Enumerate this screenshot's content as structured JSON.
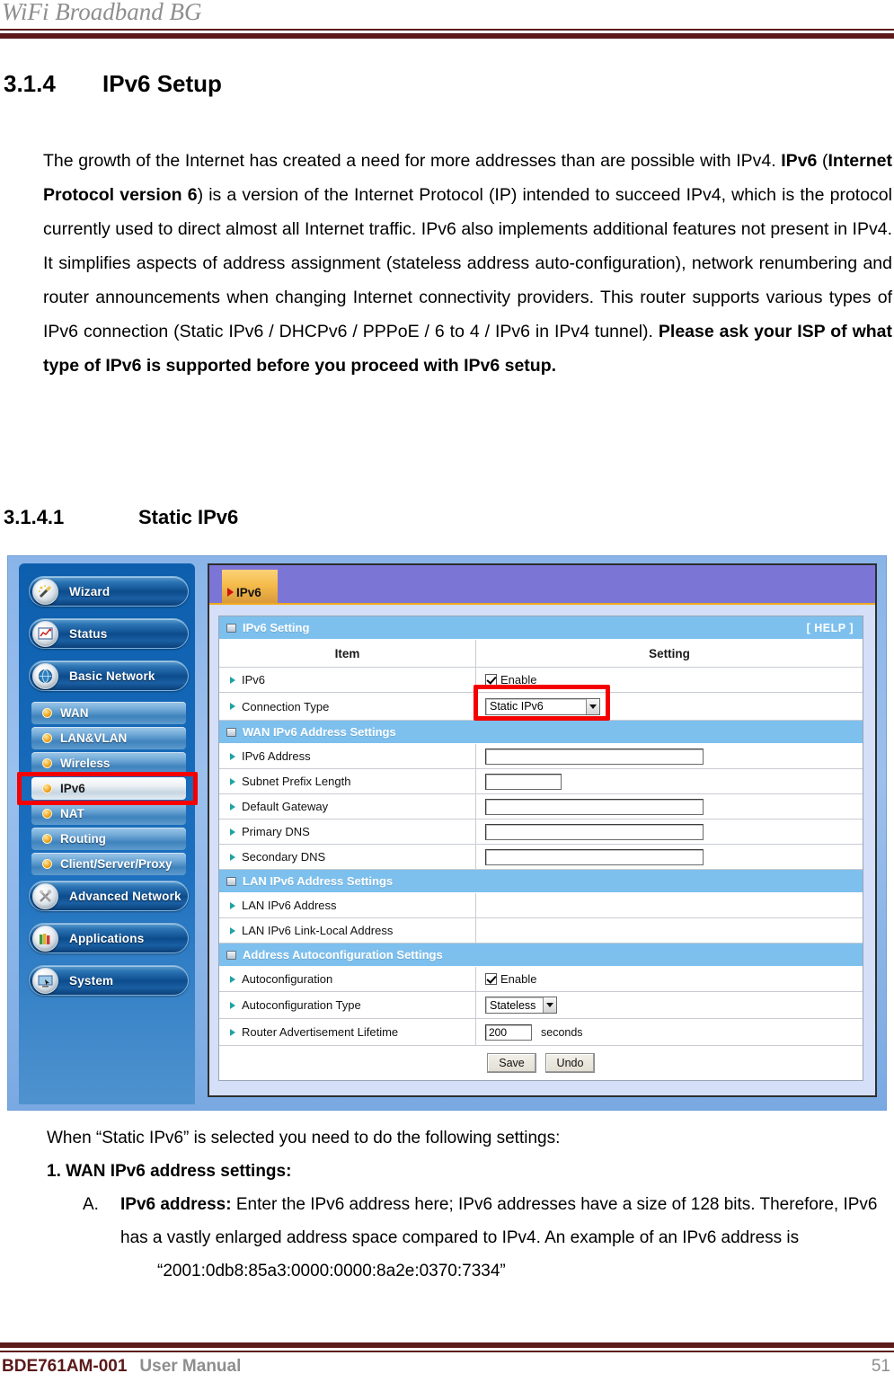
{
  "header": {
    "doc_title": "WiFi Broadband BG"
  },
  "sections": {
    "s314_num": "3.1.4",
    "s314_title": "IPv6 Setup",
    "s3141_num": "3.1.4.1",
    "s3141_title": "Static IPv6"
  },
  "intro_paragraph": {
    "part1": "The growth of the Internet has created a need for more addresses than are possible with IPv4. ",
    "bold1": "IPv6",
    "part2": " (",
    "bold2": "Internet Protocol version 6",
    "part3": ") is a version of the Internet Protocol (IP) intended to succeed IPv4, which is the protocol currently used to direct almost all Internet traffic. IPv6 also implements additional features not present in IPv4. It simplifies aspects of address assignment (stateless address auto-configuration), network renumbering and router announcements when changing Internet connectivity providers. This router supports various types of IPv6 connection (Static IPv6 / DHCPv6 / PPPoE / 6 to 4 / IPv6 in IPv4 tunnel). ",
    "bold3": "Please ask your ISP of what type of IPv6 is supported before you proceed with IPv6 setup."
  },
  "router_ui": {
    "sidebar": {
      "buttons": [
        {
          "label": "Wizard",
          "icon": "wand-icon"
        },
        {
          "label": "Status",
          "icon": "chart-icon"
        },
        {
          "label": "Basic Network",
          "icon": "globe-icon"
        }
      ],
      "sub_items": [
        {
          "label": "WAN",
          "active": false
        },
        {
          "label": "LAN&VLAN",
          "active": false
        },
        {
          "label": "Wireless",
          "active": false
        },
        {
          "label": "IPv6",
          "active": true
        },
        {
          "label": "NAT",
          "active": false
        },
        {
          "label": "Routing",
          "active": false
        },
        {
          "label": "Client/Server/Proxy",
          "active": false
        }
      ],
      "buttons2": [
        {
          "label": "Advanced Network",
          "icon": "tools-icon"
        },
        {
          "label": "Applications",
          "icon": "books-icon"
        },
        {
          "label": "System",
          "icon": "monitor-icon"
        }
      ]
    },
    "tab": {
      "label": "IPv6"
    },
    "settings": {
      "group1_title": "IPv6 Setting",
      "help_label": "[ HELP ]",
      "col_item": "Item",
      "col_setting": "Setting",
      "row_ipv6_label": "IPv6",
      "row_ipv6_enable": "Enable",
      "row_conn_label": "Connection Type",
      "row_conn_value": "Static IPv6",
      "group2_title": "WAN IPv6 Address Settings",
      "wan_rows": [
        {
          "label": "IPv6 Address",
          "value": "",
          "field": "wide"
        },
        {
          "label": "Subnet Prefix Length",
          "value": "",
          "field": "narrow"
        },
        {
          "label": "Default Gateway",
          "value": "",
          "field": "wide"
        },
        {
          "label": "Primary DNS",
          "value": "",
          "field": "wide"
        },
        {
          "label": "Secondary DNS",
          "value": "",
          "field": "wide"
        }
      ],
      "group3_title": "LAN IPv6 Address Settings",
      "lan_rows": [
        {
          "label": "LAN IPv6 Address",
          "value": ""
        },
        {
          "label": "LAN IPv6 Link-Local Address",
          "value": ""
        }
      ],
      "group4_title": "Address Autoconfiguration Settings",
      "row_autoconf_label": "Autoconfiguration",
      "row_autoconf_enable": "Enable",
      "row_autoconf_type_label": "Autoconfiguration Type",
      "row_autoconf_type_value": "Stateless",
      "row_ra_label": "Router Advertisement Lifetime",
      "row_ra_value": "200",
      "row_ra_unit": "seconds",
      "save_label": "Save",
      "undo_label": "Undo"
    }
  },
  "post_text": {
    "line1": "When “Static IPv6” is selected you need to do the following settings:",
    "line2": "1. WAN IPv6 address settings:",
    "item_a_marker": "A.",
    "item_a_bold": "IPv6 address:",
    "item_a_rest": " Enter the IPv6 address here; IPv6 addresses have a size of 128 bits. Therefore, IPv6 has a vastly enlarged address space compared to IPv4. An example of an IPv6 address is",
    "example": "“2001:0db8:85a3:0000:0000:8a2e:0370:7334”"
  },
  "footer": {
    "code": "BDE761AM-001",
    "manual": "User Manual",
    "page": "51"
  },
  "colors": {
    "rule": "#5c1a1a",
    "nav_blue": "#0d5fae",
    "group_blue": "#7dc0ee",
    "tab_purple": "#7b76d6",
    "tab_orange": "#f5bc4c",
    "highlight_red": "#f50000"
  }
}
